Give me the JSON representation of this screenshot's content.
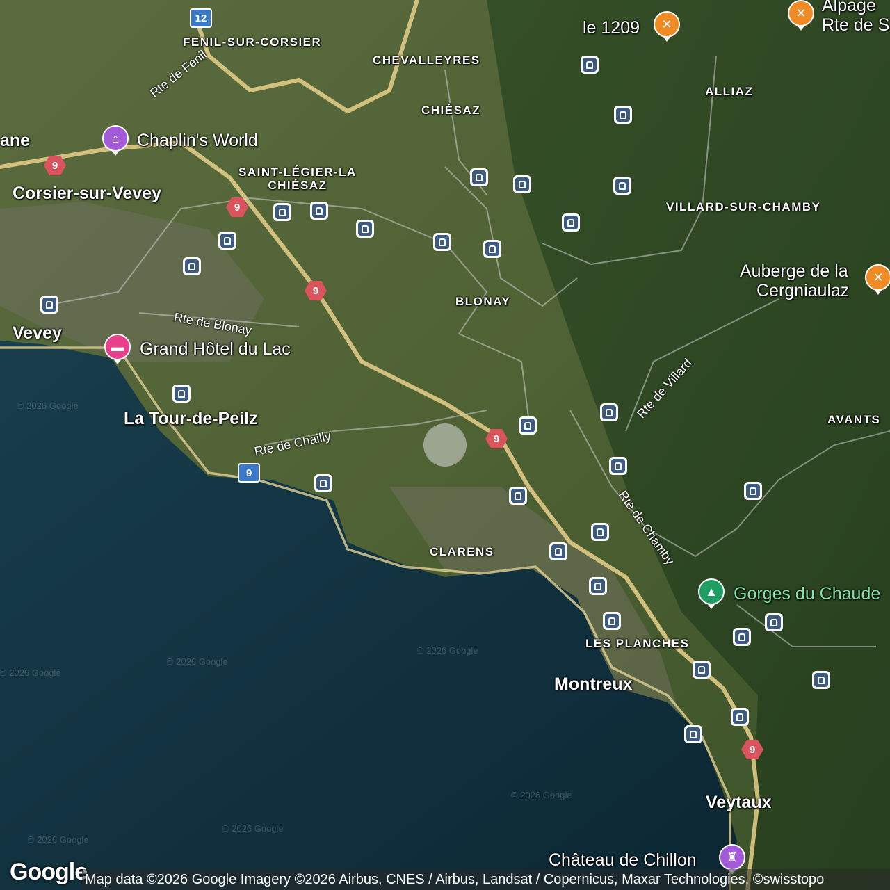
{
  "map": {
    "type": "satellite",
    "road_shields": {
      "a12": "12",
      "a9": "9",
      "m9": "9"
    },
    "localities": {
      "fenil": "FENIL-SUR-CORSIER",
      "chevalleyres": "CHEVALLEYRES",
      "alliaz": "ALLIAZ",
      "chiesaz": "CHIÉSAZ",
      "saint_legier": "SAINT-LÉGIER-LA\nCHIÉSAZ",
      "villard": "VILLARD-SUR-CHAMBY",
      "blonay": "BLONAY",
      "avants": "AVANTS",
      "clarens": "CLARENS",
      "les_planches": "LES PLANCHES"
    },
    "towns": {
      "ane": "ane",
      "corsier": "Corsier-sur-Vevey",
      "vevey": "Vevey",
      "tour": "La Tour-de-Peilz",
      "montreux": "Montreux",
      "veytaux": "Veytaux"
    },
    "pois": {
      "le1209": "le 1209",
      "alpage1": "Alpage",
      "alpage2": "Rte de S",
      "chaplin": "Chaplin's World",
      "grand_hotel": "Grand Hôtel du Lac",
      "auberge1": "Auberge de la",
      "auberge2": "Cergniaulaz",
      "gorges": "Gorges du Chaude",
      "chillon": "Château de Chillon"
    },
    "roads": {
      "fenil": "Rte de Fenil",
      "blonay": "Rte de Blonay",
      "chailly": "Rte de Chailly",
      "villard": "Rte de Villard",
      "chamby": "Rte de Chamby"
    },
    "watermark": "© 2026 Google",
    "logo": "Google",
    "attribution": "Map data ©2026 Google Imagery ©2026 Airbus, CNES / Airbus, Landsat / Copernicus, Maxar Technologies, ©swisstopo"
  }
}
